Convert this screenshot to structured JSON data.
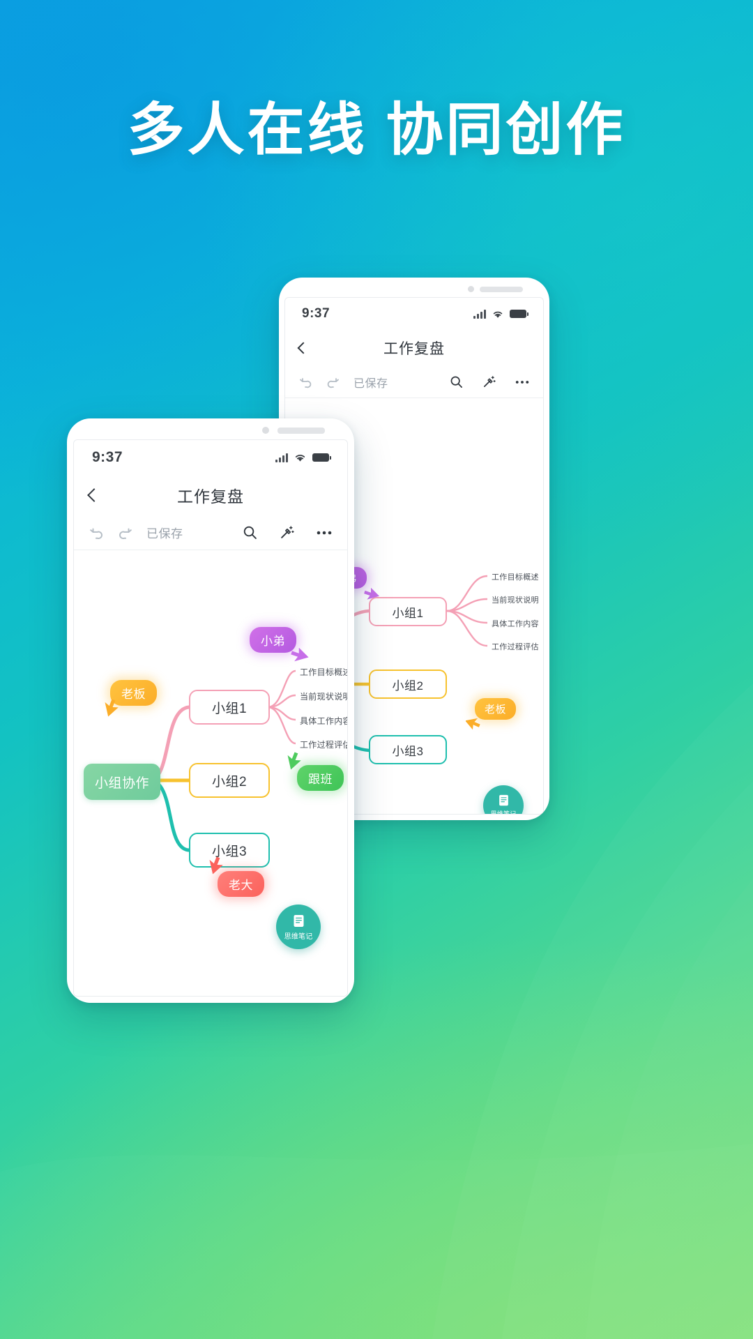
{
  "background": {
    "gradient_start": "#0aa6e0",
    "gradient_mid": "#13c2c2",
    "gradient_end": "#7fe07c"
  },
  "headline": {
    "text": "多人在线 协同创作",
    "color": "#ffffff"
  },
  "phone_back": {
    "status": {
      "time": "9:37",
      "signal_icon": "signal-bars-icon",
      "wifi_icon": "wifi-icon",
      "battery_icon": "battery-full-icon"
    },
    "titlebar": {
      "back_icon": "back-chevron-icon",
      "title": "工作复盘"
    },
    "toolbar": {
      "undo_icon": "undo-icon",
      "redo_icon": "redo-icon",
      "saved_text": "已保存",
      "search_icon": "search-icon",
      "magic_icon": "magic-wand-icon",
      "more_icon": "more-horizontal-icon"
    },
    "mindmap": {
      "nodes": [
        {
          "label": "小组1",
          "color": "#f4a0b5"
        },
        {
          "label": "小组2",
          "color": "#f7c22e"
        },
        {
          "label": "小组3",
          "color": "#1ebfae"
        }
      ],
      "leaves": [
        "工作目标概述",
        "当前现状说明",
        "具体工作内容",
        "工作过程评估"
      ],
      "cursors": [
        {
          "label": "小弟",
          "color": "#c66ee8"
        },
        {
          "label": "老板",
          "color": "#fbad28"
        }
      ]
    },
    "fab": {
      "icon": "note-document-icon",
      "label": "思维笔记",
      "color": "#31b8a8"
    }
  },
  "phone_front": {
    "status": {
      "time": "9:37",
      "signal_icon": "signal-bars-icon",
      "wifi_icon": "wifi-icon",
      "battery_icon": "battery-full-icon"
    },
    "titlebar": {
      "back_icon": "back-chevron-icon",
      "title": "工作复盘"
    },
    "toolbar": {
      "undo_icon": "undo-icon",
      "redo_icon": "redo-icon",
      "saved_text": "已保存",
      "search_icon": "search-icon",
      "magic_icon": "magic-wand-icon",
      "more_icon": "more-horizontal-icon"
    },
    "mindmap": {
      "root": {
        "label": "小组协作",
        "color": "#7ccfa0"
      },
      "nodes": [
        {
          "label": "小组1",
          "color": "#f4a0b5"
        },
        {
          "label": "小组2",
          "color": "#f7c22e"
        },
        {
          "label": "小组3",
          "color": "#1ebfae"
        }
      ],
      "leaves": [
        "工作目标概述",
        "当前现状说明",
        "具体工作内容",
        "工作过程评估"
      ],
      "cursors": [
        {
          "label": "小弟",
          "color": "#c66ee8"
        },
        {
          "label": "老板",
          "color": "#fbad28"
        },
        {
          "label": "跟班",
          "color": "#4ecb5e"
        },
        {
          "label": "老大",
          "color": "#fb625c"
        }
      ]
    },
    "fab": {
      "icon": "note-document-icon",
      "label": "思维笔记",
      "color": "#31b8a8"
    }
  }
}
